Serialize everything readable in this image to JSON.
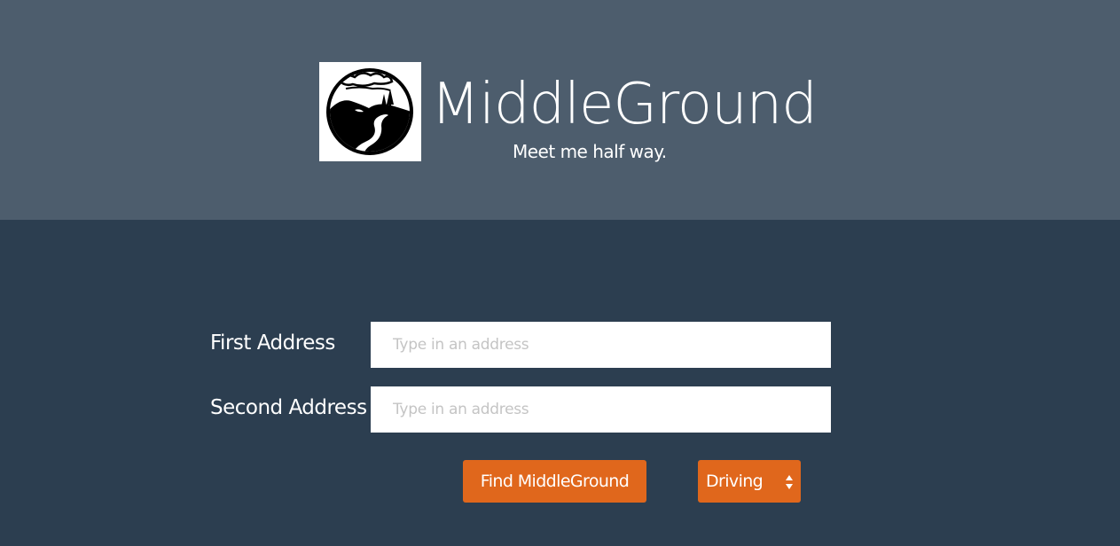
{
  "header": {
    "brand_name": "MiddleGround",
    "tagline": "Meet me half way.",
    "logo_icon": "landscape-logo-icon",
    "background_color": "#4d5d6d"
  },
  "form": {
    "first_address": {
      "label": "First Address",
      "placeholder": "Type in an address",
      "value": ""
    },
    "second_address": {
      "label": "Second Address",
      "placeholder": "Type in an address",
      "value": ""
    },
    "find_button_label": "Find MiddleGround",
    "travel_mode": {
      "selected": "Driving",
      "icon": "select-arrows-icon"
    },
    "background_color": "#2c3e50",
    "accent_color": "#e0671c"
  }
}
